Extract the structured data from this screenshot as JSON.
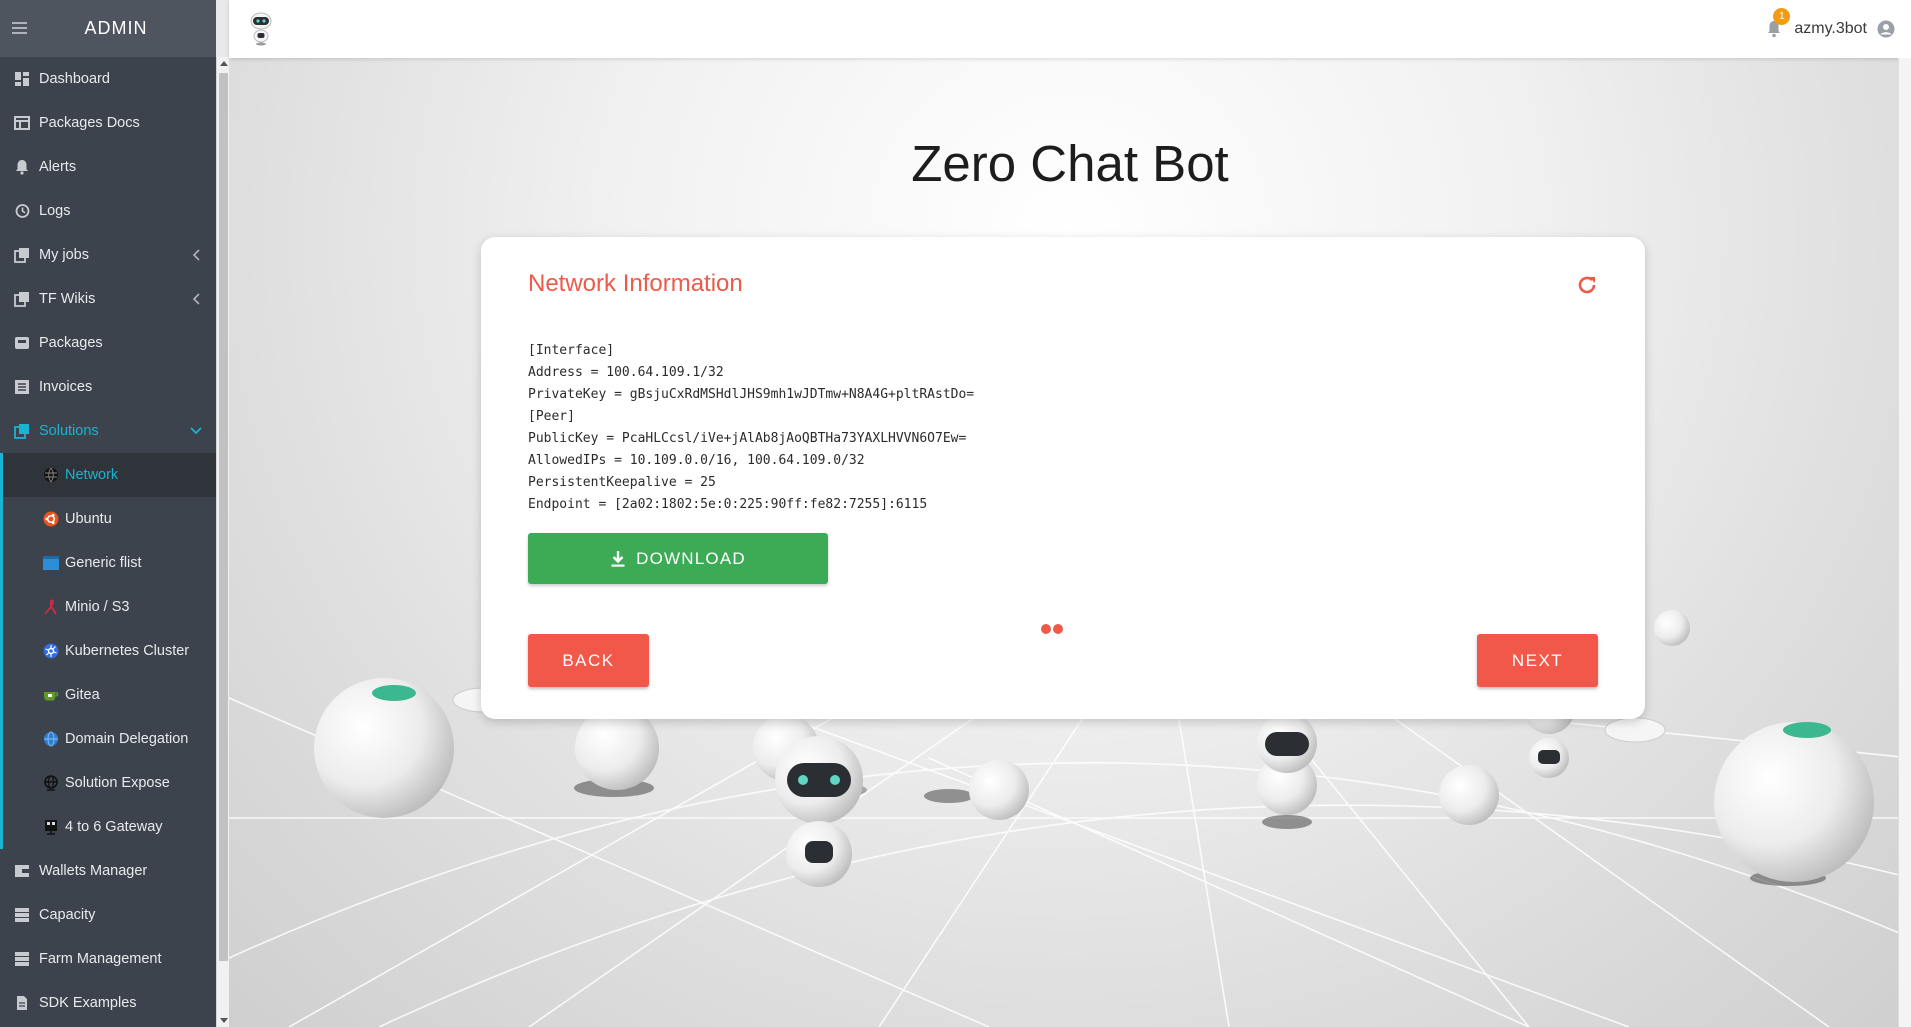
{
  "sidebar": {
    "brand": "ADMIN",
    "items": [
      {
        "label": "Dashboard",
        "icon": "dashboard-icon"
      },
      {
        "label": "Packages Docs",
        "icon": "table-icon"
      },
      {
        "label": "Alerts",
        "icon": "bell-icon"
      },
      {
        "label": "Logs",
        "icon": "history-icon"
      },
      {
        "label": "My jobs",
        "icon": "copy-icon"
      },
      {
        "label": "TF Wikis",
        "icon": "copy-icon"
      },
      {
        "label": "Packages",
        "icon": "package-icon"
      },
      {
        "label": "Invoices",
        "icon": "list-icon"
      },
      {
        "label": "Solutions",
        "icon": "copy-icon"
      }
    ],
    "solutions": [
      {
        "label": "Network",
        "icon": "network-globe-icon"
      },
      {
        "label": "Ubuntu",
        "icon": "ubuntu-icon"
      },
      {
        "label": "Generic flist",
        "icon": "flist-icon"
      },
      {
        "label": "Minio / S3",
        "icon": "minio-icon"
      },
      {
        "label": "Kubernetes Cluster",
        "icon": "kubernetes-icon"
      },
      {
        "label": "Gitea",
        "icon": "gitea-icon"
      },
      {
        "label": "Domain Delegation",
        "icon": "domain-icon"
      },
      {
        "label": "Solution Expose",
        "icon": "globe-icon"
      },
      {
        "label": "4 to 6 Gateway",
        "icon": "gateway-icon"
      }
    ],
    "bottom": [
      {
        "label": "Wallets Manager",
        "icon": "wallet-icon"
      },
      {
        "label": "Capacity",
        "icon": "server-icon"
      },
      {
        "label": "Farm Management",
        "icon": "server-icon"
      },
      {
        "label": "SDK Examples",
        "icon": "document-icon"
      }
    ]
  },
  "topbar": {
    "notification_count": "1",
    "username": "azmy.3bot"
  },
  "main": {
    "title": "Zero Chat Bot",
    "card": {
      "title": "Network Information",
      "config_lines": [
        "[Interface]",
        "Address = 100.64.109.1/32",
        "PrivateKey = gBsjuCxRdMSHdlJHS9mh1wJDTmw+N8A4G+pltRAstDo=",
        "[Peer]",
        "PublicKey = PcaHLCcsl/iVe+jAlAb8jAoQBTHa73YAXLHVVN6O7Ew=",
        "AllowedIPs = 10.109.0.0/16, 100.64.109.0/32",
        "PersistentKeepalive = 25",
        "Endpoint = [2a02:1802:5e:0:225:90ff:fe82:7255]:6115"
      ],
      "download_label": "DOWNLOAD",
      "back_label": "BACK",
      "next_label": "NEXT"
    }
  },
  "colors": {
    "accent_red": "#ed5a4a",
    "download_green": "#3daa56",
    "sidebar_active": "#19b3d3",
    "sidebar_bg": "#3d434c"
  }
}
